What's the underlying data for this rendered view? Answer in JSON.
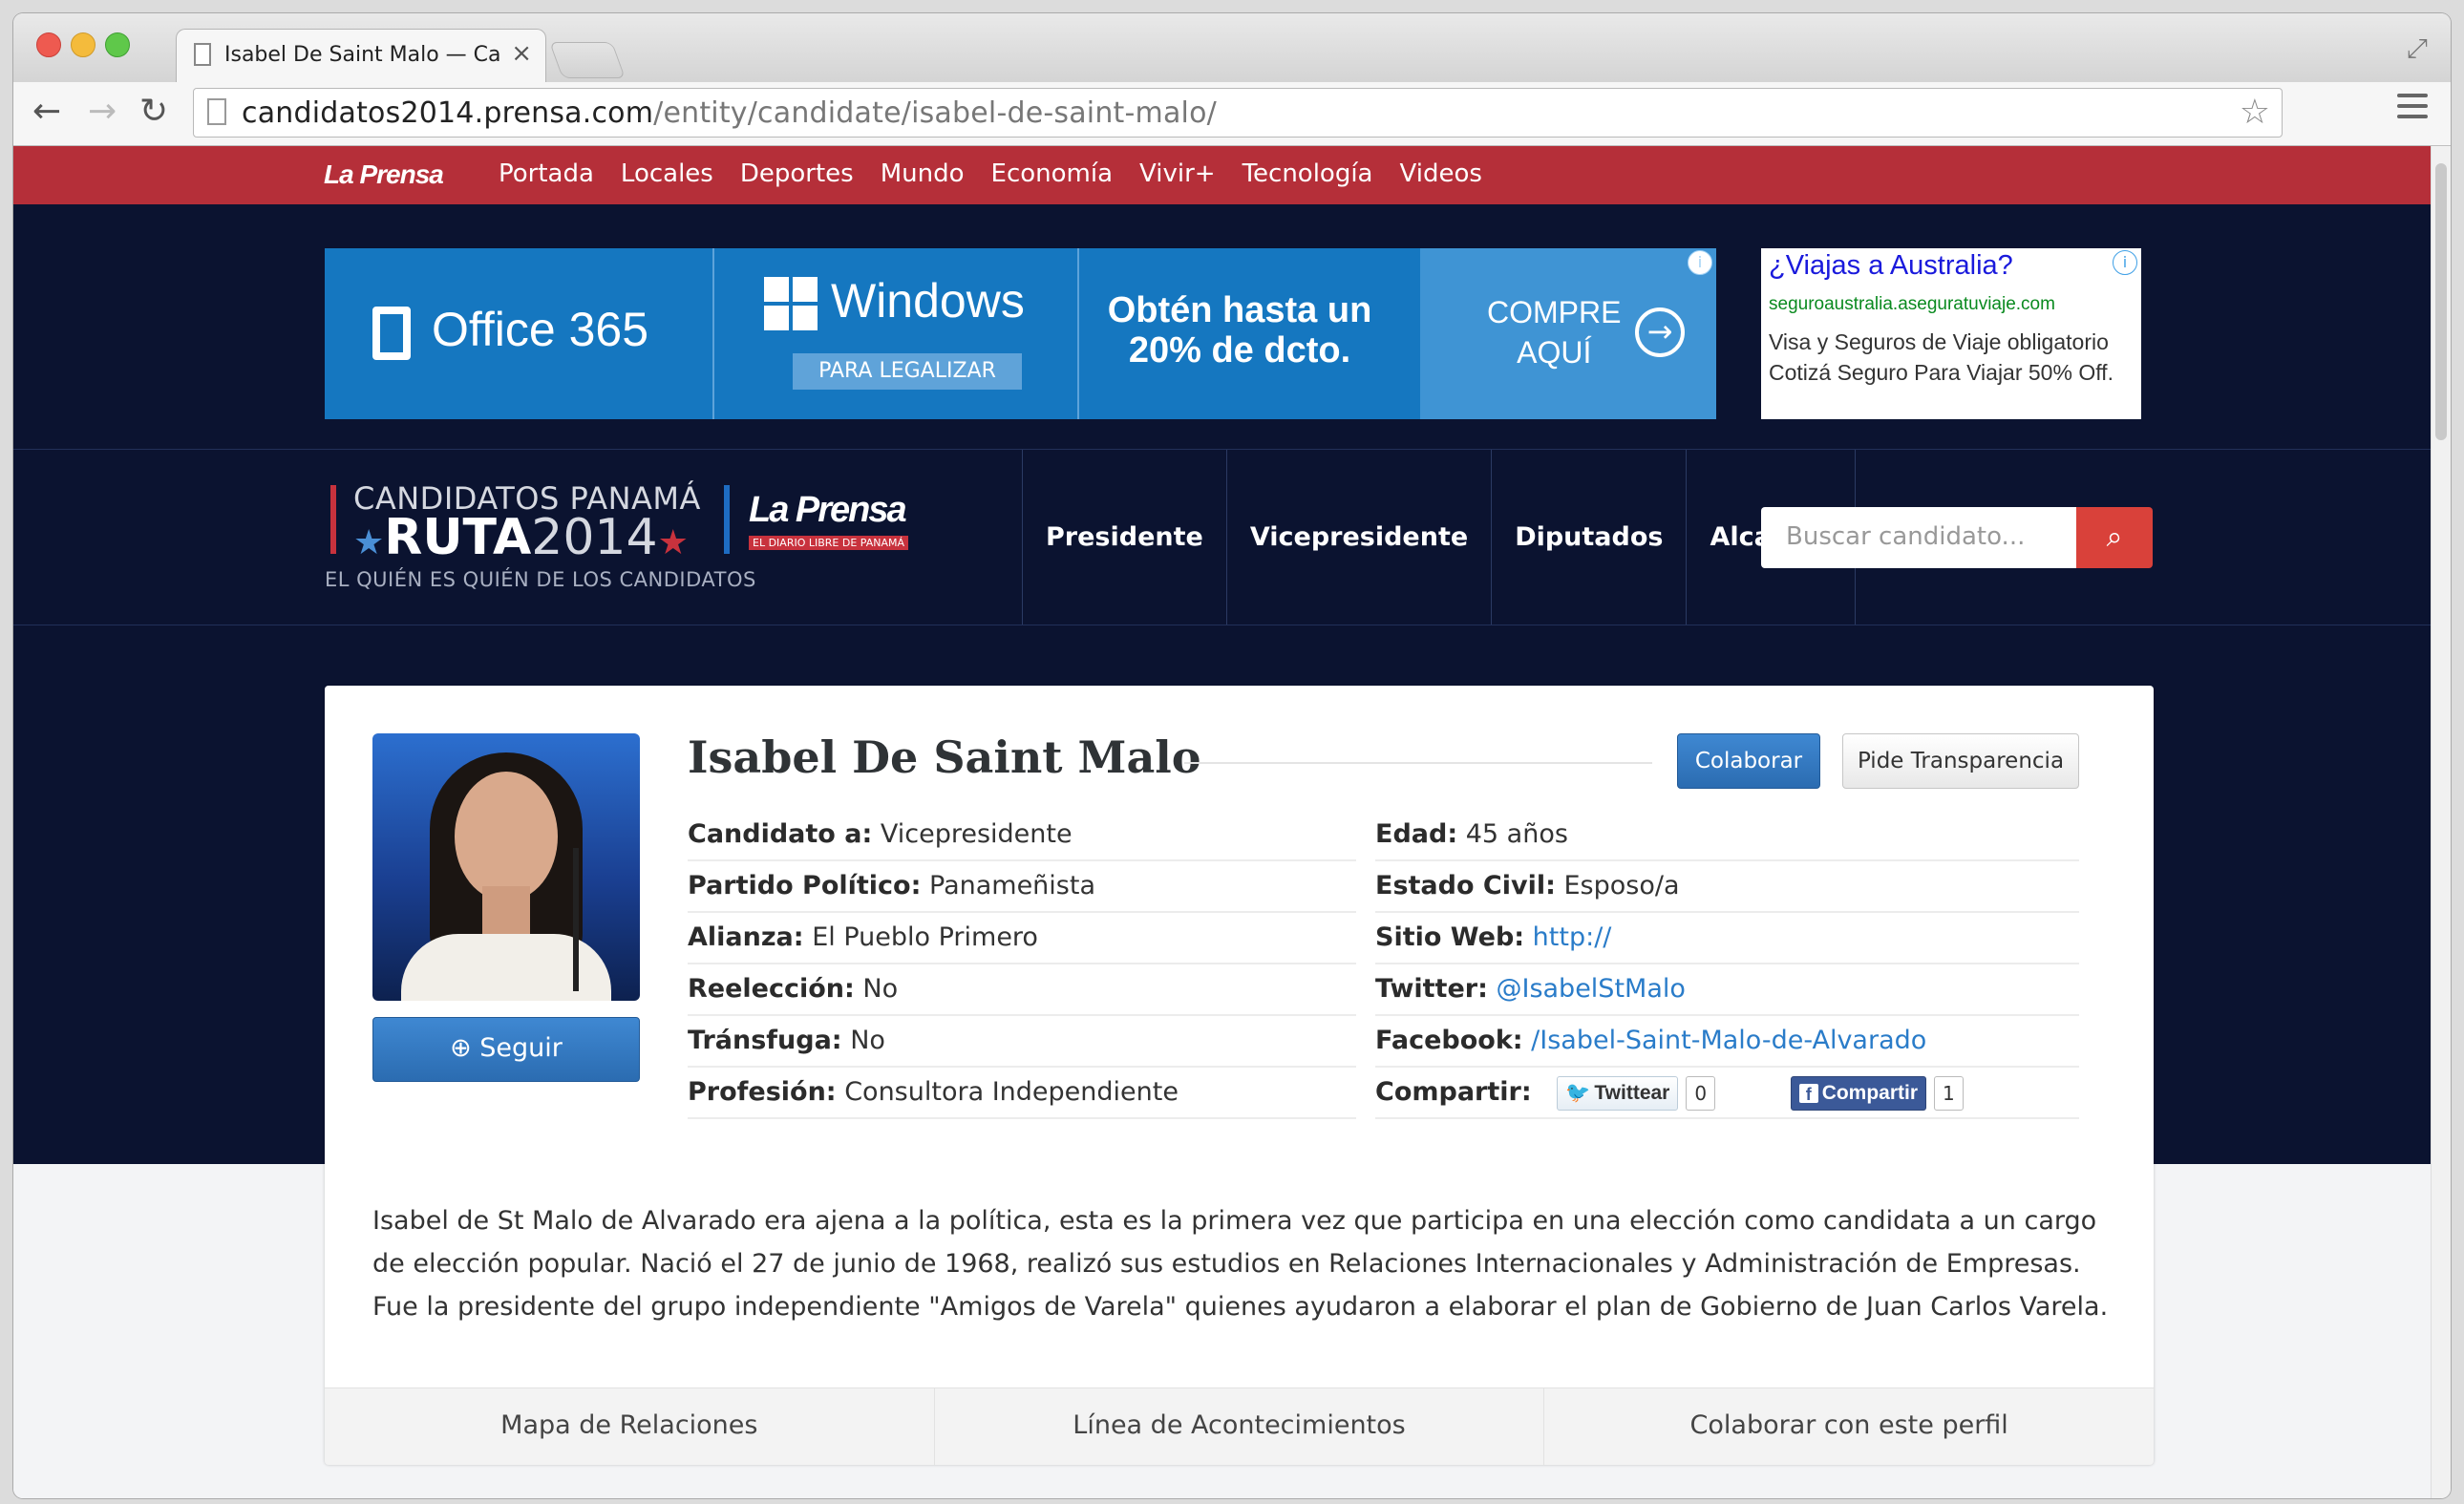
{
  "browser": {
    "tab_title": "Isabel De Saint Malo — Candidatos",
    "url_domain": "candidatos2014.prensa.com",
    "url_path": "/entity/candidate/isabel-de-saint-malo/"
  },
  "topnav": {
    "logo": "La Prensa",
    "items": [
      "Portada",
      "Locales",
      "Deportes",
      "Mundo",
      "Economía",
      "Vivir+",
      "Tecnología",
      "Videos"
    ]
  },
  "ad_banner": {
    "office": "Office 365",
    "windows": "Windows",
    "legalizar": "PARA LEGALIZAR",
    "promo": "Obtén hasta un 20% de dcto.",
    "compre": "COMPRE",
    "aqui": "AQUÍ",
    "info": "i"
  },
  "ad_text": {
    "title": "¿Viajas a Australia?",
    "url": "seguroaustralia.aseguratuviaje.com",
    "body": "Visa y Seguros de Viaje obligatorio Cotizá Seguro Para Viajar 50% Off.",
    "info": "i"
  },
  "site_logo": {
    "top": "CANDIDATOS PANAMÁ",
    "ruta": "RUTA",
    "year": "2014",
    "star": "★",
    "brand": "La Prensa",
    "brand_sub": "EL DIARIO LIBRE DE PANAMÁ",
    "tagline": "EL QUIÉN ES QUIÉN DE LOS CANDIDATOS"
  },
  "site_nav": [
    "Presidente",
    "Vicepresidente",
    "Diputados",
    "Alcaldes"
  ],
  "search": {
    "placeholder": "Buscar candidato..."
  },
  "profile": {
    "name": "Isabel De Saint Malo",
    "follow": "Seguir",
    "collab_btn": "Colaborar",
    "transparency_btn": "Pide Transparencia",
    "fields_left": [
      {
        "label": "Candidato a:",
        "value": "Vicepresidente"
      },
      {
        "label": "Partido Político:",
        "value": "Panameñista"
      },
      {
        "label": "Alianza:",
        "value": "El Pueblo Primero"
      },
      {
        "label": "Reelección:",
        "value": "No"
      },
      {
        "label": "Tránsfuga:",
        "value": "No"
      },
      {
        "label": "Profesión:",
        "value": "Consultora Independiente"
      }
    ],
    "fields_right": [
      {
        "label": "Edad:",
        "value": "45 años"
      },
      {
        "label": "Estado Civil:",
        "value": "Esposo/a"
      },
      {
        "label": "Sitio Web:",
        "value": "http://"
      },
      {
        "label": "Twitter:",
        "value": "@IsabelStMalo"
      },
      {
        "label": "Facebook:",
        "value": "/Isabel-Saint-Malo-de-Alvarado"
      }
    ],
    "share": {
      "label": "Compartir:",
      "twitter": "Twittear",
      "twitter_count": "0",
      "facebook": "Compartir",
      "facebook_count": "1"
    },
    "bio": "Isabel de St Malo de Alvarado era ajena a la política, esta es la primera vez que participa en una elección como candidata a un cargo de elección popular. Nació el 27 de junio de 1968, realizó sus estudios en Relaciones Internacionales y Administración de Empresas. Fue la presidente del grupo independiente \"Amigos de Varela\" quienes ayudaron a elaborar el plan de Gobierno de Juan Carlos Varela.",
    "tabs": [
      "Mapa de Relaciones",
      "Línea de Acontecimientos",
      "Colaborar con este perfil"
    ]
  },
  "colors": {
    "topbar": "#b52f39",
    "dark_bg": "#0b1330",
    "accent_blue": "#2b6cb1",
    "search_red": "#d9413a"
  }
}
